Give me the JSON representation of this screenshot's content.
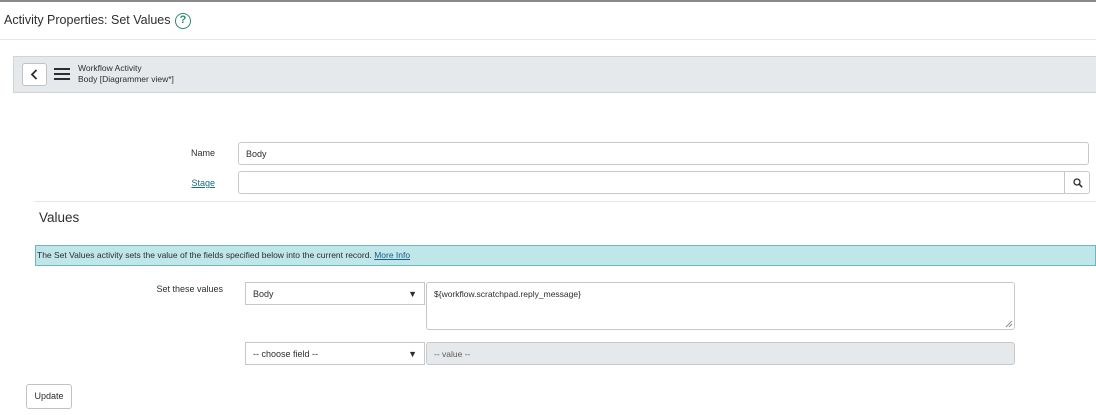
{
  "page": {
    "title": "Activity Properties: Set Values",
    "help_icon_glyph": "?"
  },
  "form_header": {
    "table_label": "Workflow Activity",
    "record_label": "Body [Diagrammer view*]"
  },
  "fields": {
    "name_label": "Name",
    "name_value": "Body",
    "stage_label": "Stage",
    "stage_value": ""
  },
  "values_section": {
    "title": "Values",
    "info_text": "The Set Values activity sets the value of the fields specified below into the current record.",
    "info_link": "More Info",
    "set_values_label": "Set these values",
    "rows": [
      {
        "field": "Body",
        "value": "${workflow.scratchpad.reply_message}"
      },
      {
        "field": "-- choose field --",
        "value_placeholder": "-- value --"
      }
    ]
  },
  "actions": {
    "update_label": "Update"
  },
  "icons": {
    "back": "chevron-left-icon",
    "menu": "hamburger-menu-icon",
    "lookup": "search-icon",
    "dropdown": "caret-down-icon"
  },
  "colors": {
    "accent": "#278c6b",
    "info_banner": "#bfe6e8",
    "link": "#1f6c83",
    "header_bar": "#e6e9eb"
  }
}
